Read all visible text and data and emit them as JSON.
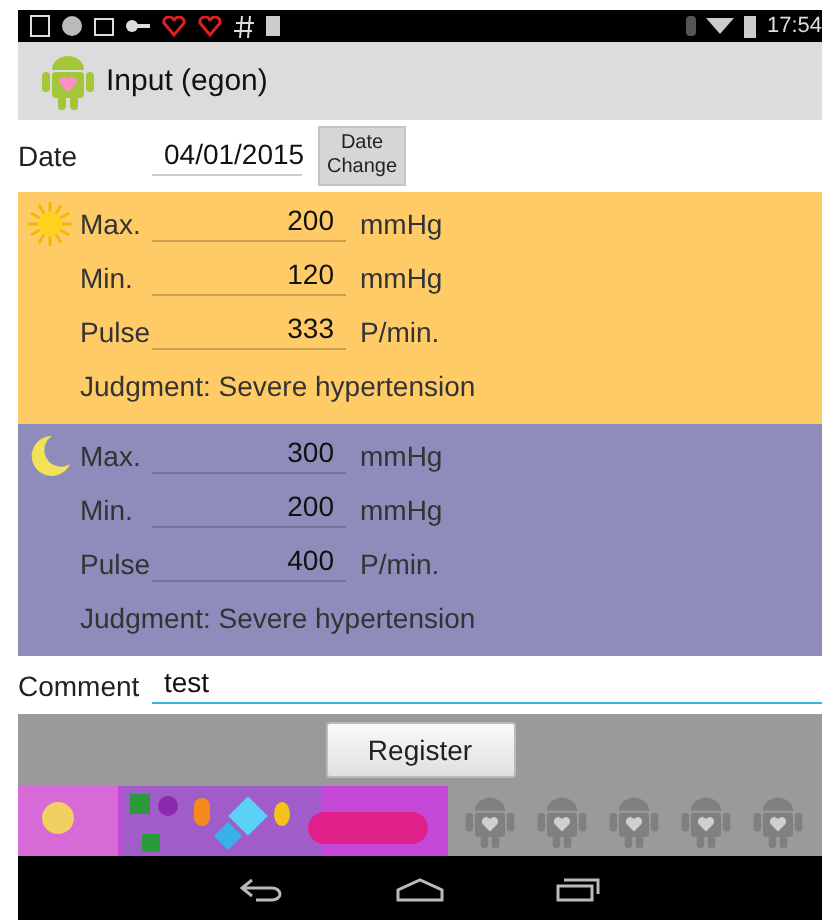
{
  "status_bar": {
    "time": "17:54"
  },
  "action_bar": {
    "title": "Input (egon)"
  },
  "date": {
    "label": "Date",
    "value": "04/01/2015",
    "button": "Date Change"
  },
  "readings": [
    {
      "kind": "day",
      "rows": [
        {
          "label": "Max.",
          "value": "200",
          "unit": "mmHg"
        },
        {
          "label": "Min.",
          "value": "120",
          "unit": "mmHg"
        },
        {
          "label": "Pulse",
          "value": "333",
          "unit": "P/min."
        }
      ],
      "judgment": "Judgment: Severe hypertension"
    },
    {
      "kind": "night",
      "rows": [
        {
          "label": "Max.",
          "value": "300",
          "unit": "mmHg"
        },
        {
          "label": "Min.",
          "value": "200",
          "unit": "mmHg"
        },
        {
          "label": "Pulse",
          "value": "400",
          "unit": "P/min."
        }
      ],
      "judgment": "Judgment: Severe hypertension"
    }
  ],
  "comment": {
    "label": "Comment",
    "value": "test"
  },
  "register_button": "Register"
}
